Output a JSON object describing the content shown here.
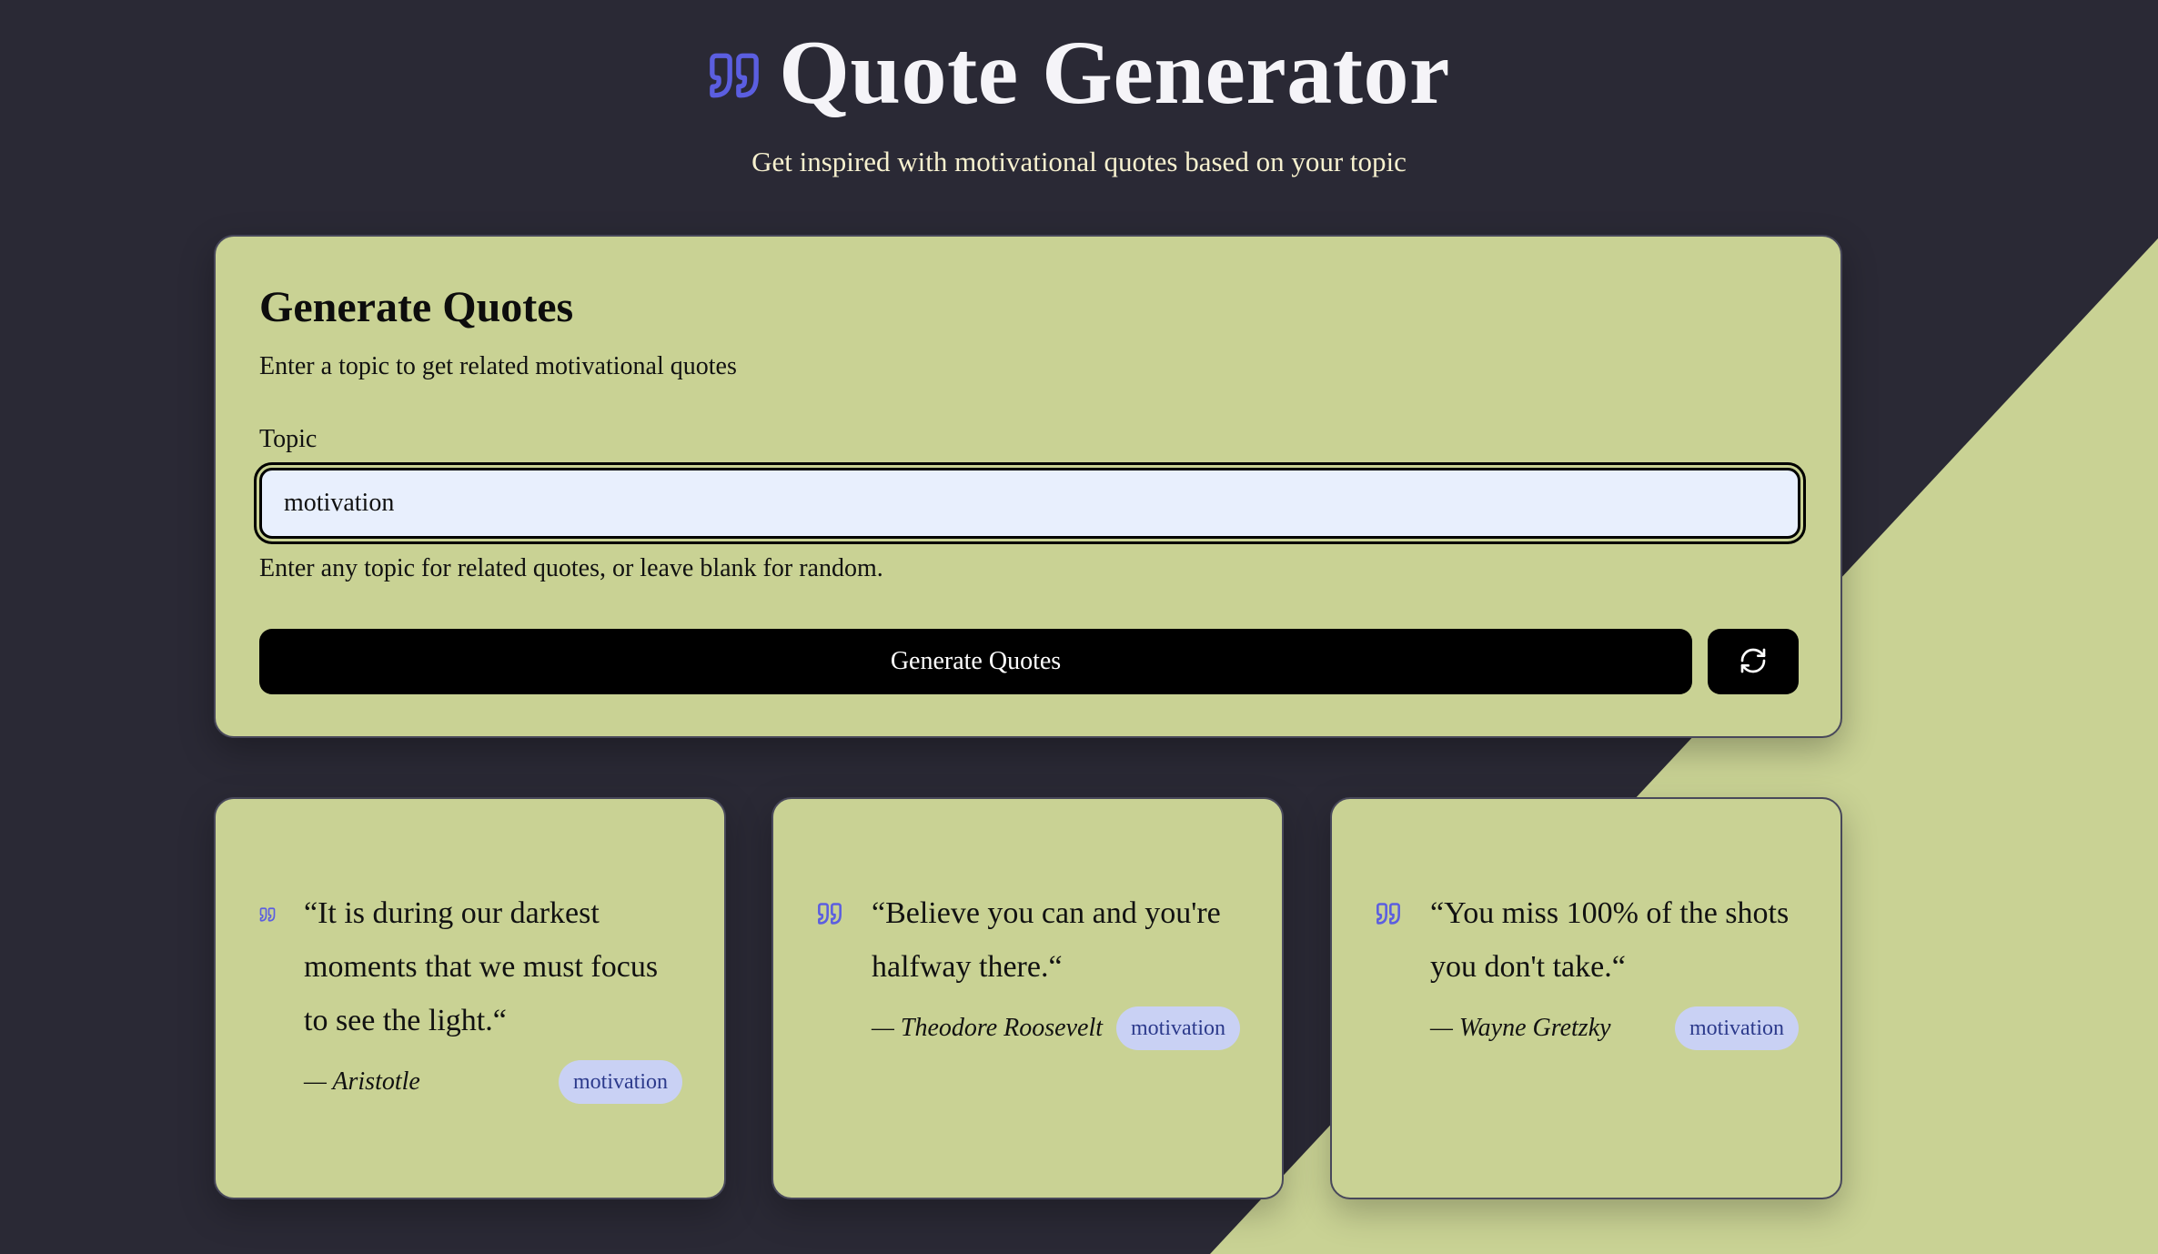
{
  "colors": {
    "background": "#2a2935",
    "card": "#c9d294",
    "accent": "#5b5ee0",
    "title": "#f5f4f8",
    "subtitle": "#f7f1cf",
    "tag_bg": "#c9d1f4",
    "tag_text": "#2c3a8c"
  },
  "header": {
    "icon": "quote-icon",
    "title": "Quote Generator",
    "subtitle": "Get inspired with motivational quotes based on your topic"
  },
  "form": {
    "title": "Generate Quotes",
    "description": "Enter a topic to get related motivational quotes",
    "topic_label": "Topic",
    "topic_value": "motivation",
    "helper": "Enter any topic for related quotes, or leave blank for random.",
    "generate_label": "Generate Quotes",
    "refresh_icon": "refresh-icon"
  },
  "quotes": [
    {
      "text": "“It is during our darkest moments that we must focus to see the light.“",
      "author": "— Aristotle",
      "tag": "motivation"
    },
    {
      "text": "“Believe you can and you're halfway there.“",
      "author": "— Theodore Roosevelt",
      "tag": "motivation"
    },
    {
      "text": "“You miss 100% of the shots you don't take.“",
      "author": "— Wayne Gretzky",
      "tag": "motivation"
    }
  ]
}
